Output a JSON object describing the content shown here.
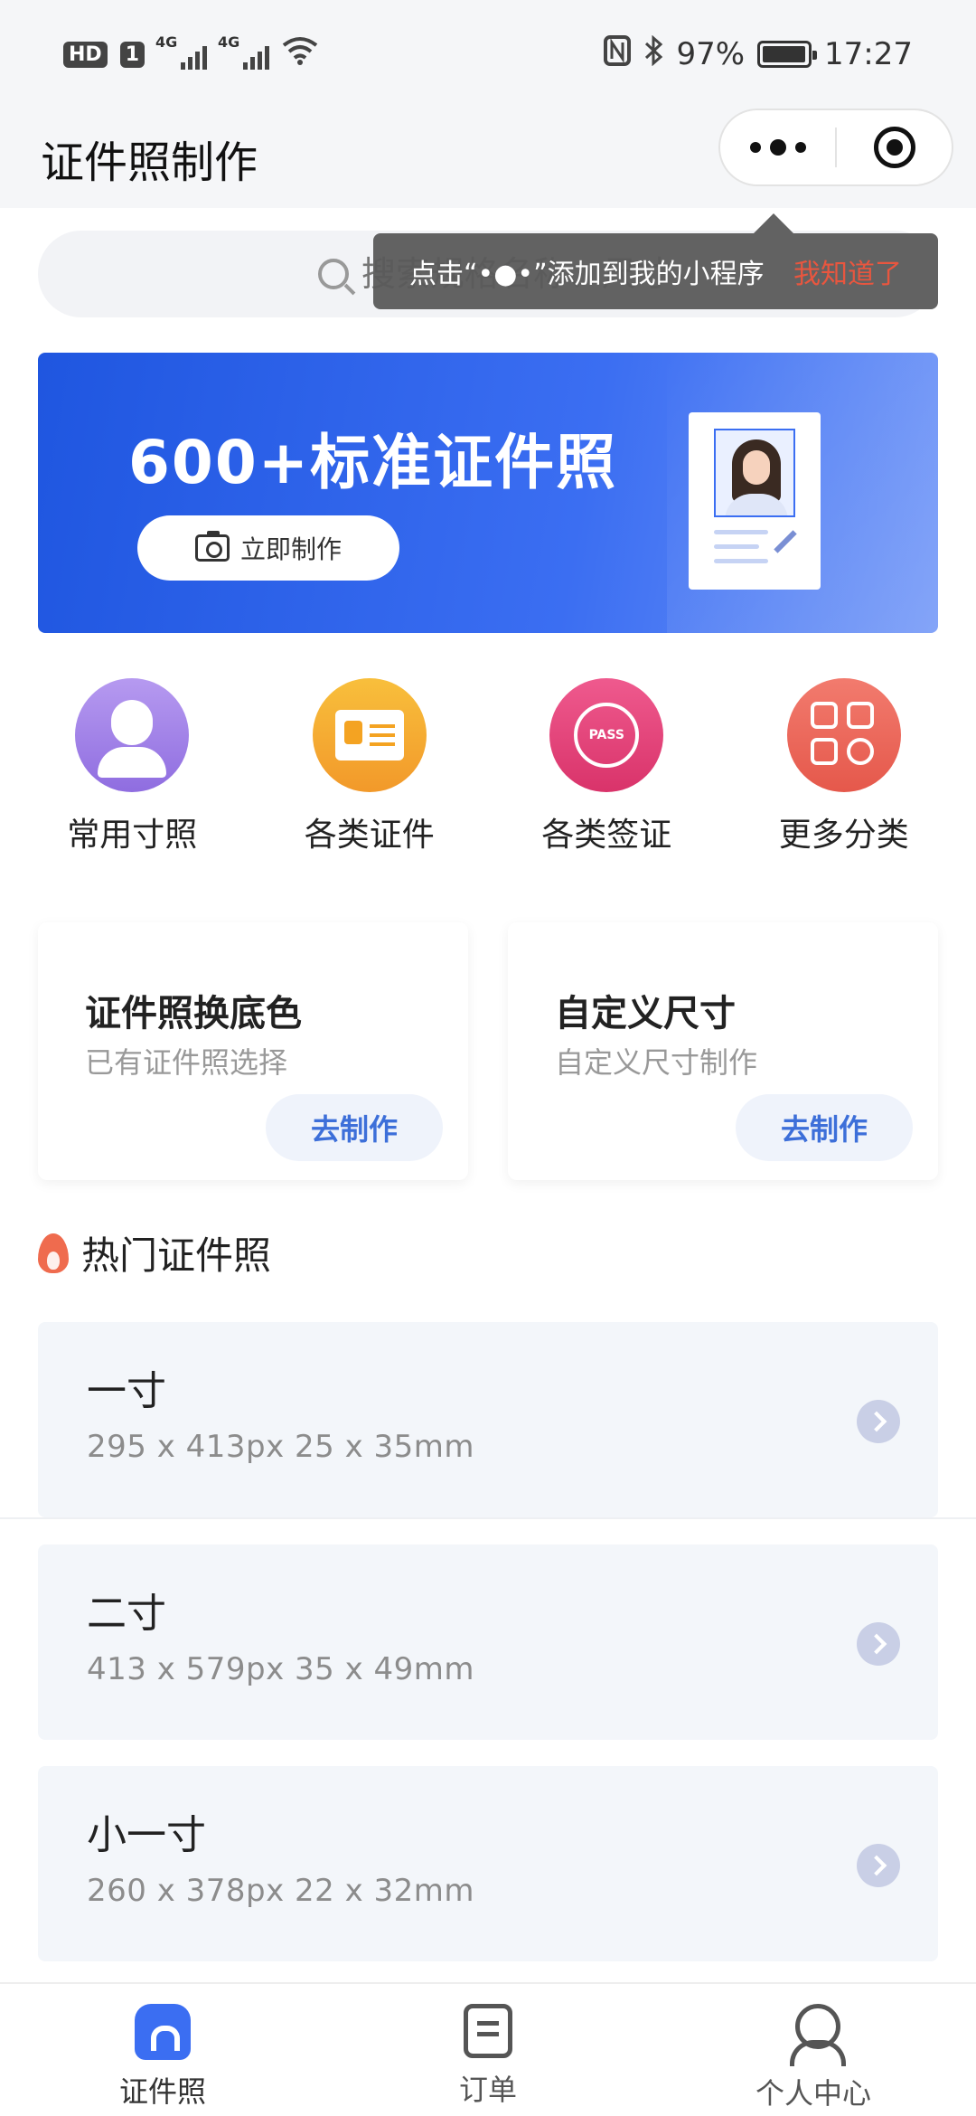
{
  "status": {
    "hd": "HD",
    "sim": "1",
    "net1": "4G",
    "net2": "4G",
    "battery_pct": "97%",
    "battery_level": 0.97,
    "time": "17:27"
  },
  "header": {
    "title": "证件照制作"
  },
  "search": {
    "placeholder": "搜索规格名称、尺寸"
  },
  "tooltip": {
    "text": "点击“•●•”添加到我的小程序",
    "dismiss": "我知道了"
  },
  "banner": {
    "title": "600+标准证件照",
    "button": "立即制作"
  },
  "categories": [
    {
      "label": "常用寸照",
      "icon": "person-icon",
      "color": "#9f7ce9"
    },
    {
      "label": "各类证件",
      "icon": "id-card-icon",
      "color": "#f4a322"
    },
    {
      "label": "各类签证",
      "icon": "passport-globe-icon",
      "color": "#e0447a",
      "badge": "PASS"
    },
    {
      "label": "更多分类",
      "icon": "grid-search-icon",
      "color": "#ee6a5c"
    }
  ],
  "features": [
    {
      "title": "证件照换底色",
      "subtitle": "已有证件照选择",
      "button": "去制作"
    },
    {
      "title": "自定义尺寸",
      "subtitle": "自定义尺寸制作",
      "button": "去制作"
    }
  ],
  "hot": {
    "title": "热门证件照",
    "items": [
      {
        "name": "一寸",
        "dims": "295 x 413px  25 x 35mm"
      },
      {
        "name": "二寸",
        "dims": "413 x 579px  35 x 49mm"
      },
      {
        "name": "小一寸",
        "dims": "260 x 378px  22 x 32mm"
      }
    ]
  },
  "tabbar": [
    {
      "label": "证件照",
      "active": true
    },
    {
      "label": "订单",
      "active": false
    },
    {
      "label": "个人中心",
      "active": false
    }
  ],
  "colors": {
    "accent": "#3b6ef2",
    "tooltip_dismiss": "#e8563f",
    "card_bg": "#f3f6fa"
  }
}
